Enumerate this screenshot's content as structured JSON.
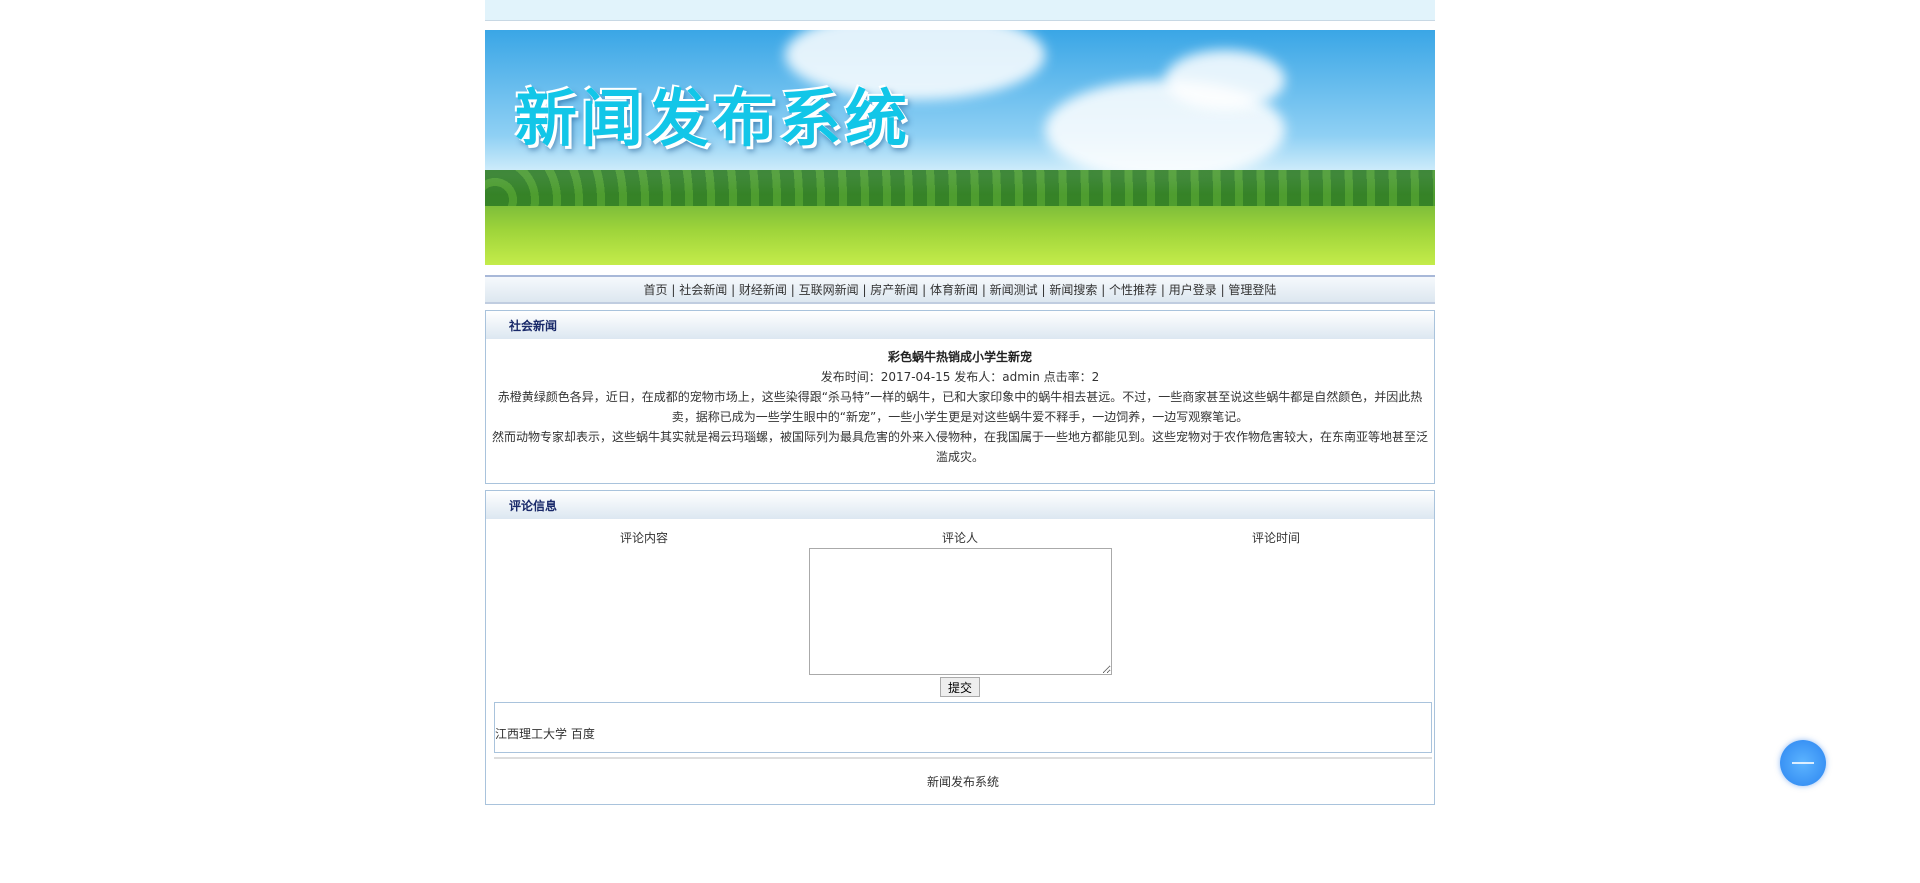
{
  "banner": {
    "title": "新闻发布系统"
  },
  "nav": [
    "首页",
    "社会新闻",
    "财经新闻",
    "互联网新闻",
    "房产新闻",
    "体育新闻",
    "新闻测试",
    "新闻搜索",
    "个性推荐",
    "用户登录",
    "管理登陆"
  ],
  "news": {
    "section": "社会新闻",
    "title": "彩色蜗牛热销成小学生新宠",
    "meta": "发布时间：2017-04-15 发布人：admin 点击率：2",
    "para1": "赤橙黄绿颜色各异，近日，在成都的宠物市场上，这些染得跟“杀马特”一样的蜗牛，已和大家印象中的蜗牛相去甚远。不过，一些商家甚至说这些蜗牛都是自然颜色，并因此热卖，据称已成为一些学生眼中的“新宠”，一些小学生更是对这些蜗牛爱不释手，一边饲养，一边写观察笔记。",
    "para2": "然而动物专家却表示，这些蜗牛其实就是褐云玛瑙螺，被国际列为最具危害的外来入侵物种，在我国属于一些地方都能见到。这些宠物对于农作物危害较大，在东南亚等地甚至泛滥成灾。"
  },
  "comments": {
    "section": "评论信息",
    "col_content": "评论内容",
    "col_author": "评论人",
    "col_time": "评论时间",
    "submit": "提交",
    "entry": "江西理工大学 百度"
  },
  "footer": "新闻发布系统"
}
